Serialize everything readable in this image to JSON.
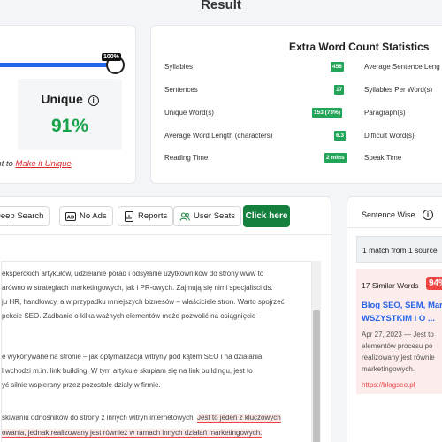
{
  "page": {
    "title": "Result"
  },
  "unique": {
    "progress_percent": 100,
    "progress_label": "100%",
    "label": "Unique",
    "value": "91%",
    "link_prefix": "ent to",
    "link_text": "Make it Unique",
    "accent": "#16a34a"
  },
  "stats": {
    "title": "Extra Word Count Statistics",
    "left": [
      {
        "label": "Syllables",
        "value": "456"
      },
      {
        "label": "Sentences",
        "value": "17"
      },
      {
        "label": "Unique Word(s)",
        "value": "153 (73%)"
      },
      {
        "label": "Average Word Length (characters)",
        "value": "6.3"
      },
      {
        "label": "Reading Time",
        "value": "2 mins"
      }
    ],
    "right": [
      {
        "label": "Average Sentence Leng"
      },
      {
        "label": "Syllables Per Word(s)"
      },
      {
        "label": "Paragraph(s)"
      },
      {
        "label": "Difficult Word(s)"
      },
      {
        "label": "Speak Time"
      }
    ],
    "badge_color": "#22a559"
  },
  "toolbar": {
    "deep_search": "Deep Search",
    "no_ads": "No Ads",
    "reports": "Reports",
    "user_seats": "User Seats",
    "click_here": "Click here",
    "cta_color": "#15803d"
  },
  "content": {
    "lines": [
      "eksperckich artykułów, udzielanie porad i odsyłanie użytkowników do strony www to",
      "arówno w strategiach marketingowych, jak i PR-owych. Zajmują się nimi specjaliści ds.",
      "ju HR, handlowcy, a w przypadku mniejszych biznesów – właściciele stron. Warto spojrzeć",
      "pekcie SEO. Zadbanie o kilka ważnych elementów może pozwolić na osiągnięcie",
      "",
      "",
      "e wykonywane na stronie – jak optymalizacja witryny pod kątem SEO i na działania",
      "l wchodzi m.in. link building. W tym artykule skupiam się na link buildingu, jest to",
      "yć silnie wspierany przez pozostałe działy w firmie.",
      "",
      "",
      "skiwaniu odnośników do strony z innych witryn internetowych."
    ],
    "highlight_1": "Jest to jeden z kluczowych",
    "highlight_2_plain": "owania, ",
    "highlight_2": "jednak realizowany jest również w ramach innych działań marketingowych."
  },
  "sentence_wise": {
    "title": "Sentence Wise",
    "match_text": "1 match from 1 source",
    "similar_words": "17 Similar Words",
    "percent": "94%",
    "result_title_1": "Blog SEO, SEM, Mark",
    "result_title_2": "WSZYSTKIM i O ...",
    "date_line": "Apr 27, 2023 — Jest to",
    "desc_1": "elementów procesu po",
    "desc_2": "realizowany jest równie",
    "desc_3": "marketingowych.",
    "link": "https://blogseo.pl"
  }
}
